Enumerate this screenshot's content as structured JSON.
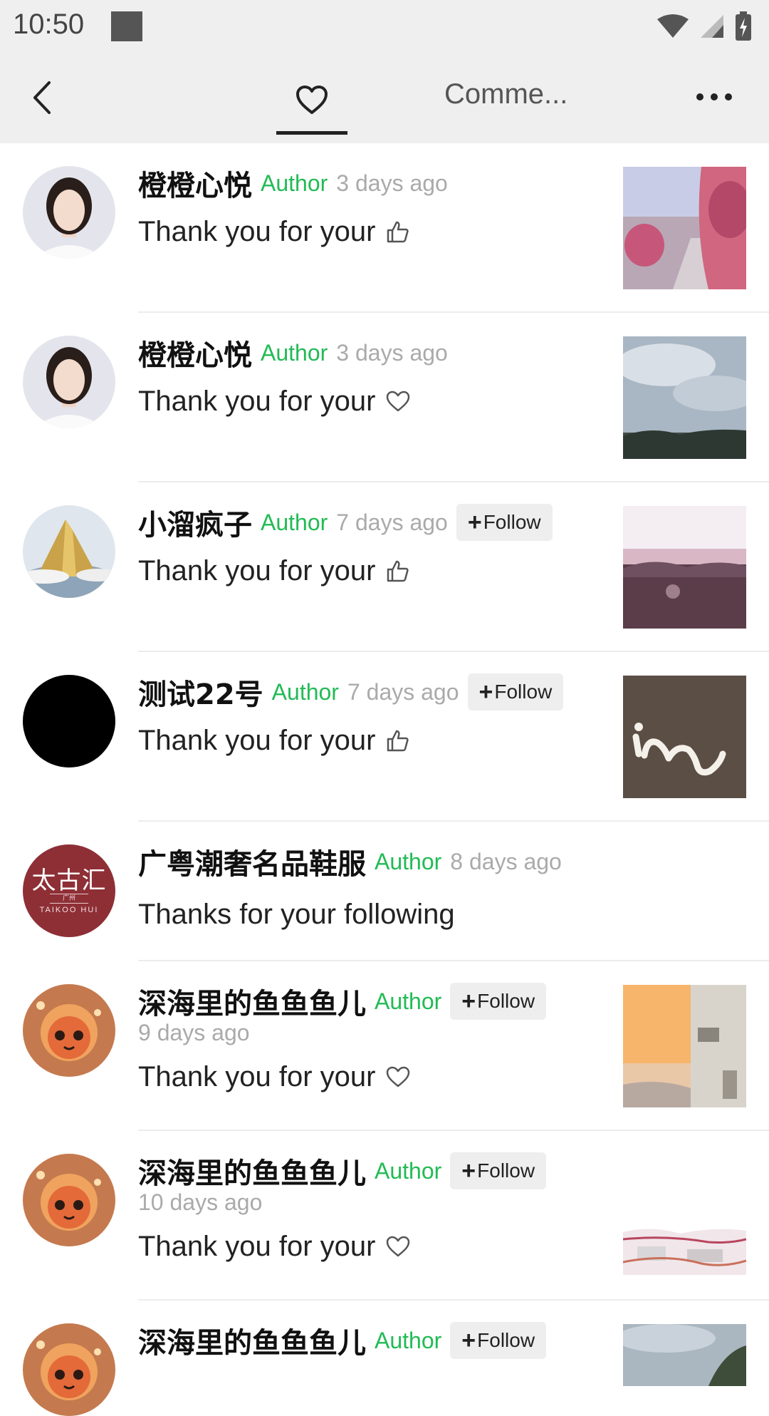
{
  "status_bar": {
    "time": "10:50"
  },
  "nav": {
    "comments_tab_label": "Comme..."
  },
  "rows": [
    {
      "username": "橙橙心悦",
      "author_tag": "Author",
      "time": "3 days ago",
      "message": "Thank you for your",
      "reaction_icon": "thumbs-up-icon"
    },
    {
      "username": "橙橙心悦",
      "author_tag": "Author",
      "time": "3 days ago",
      "message": "Thank you for your",
      "reaction_icon": "heart-icon"
    },
    {
      "username": "小溜疯子",
      "author_tag": "Author",
      "time": "7 days ago",
      "follow_label": "Follow",
      "message": "Thank you for your",
      "reaction_icon": "thumbs-up-icon"
    },
    {
      "username": "测试22号",
      "author_tag": "Author",
      "time": "7 days ago",
      "follow_label": "Follow",
      "message": "Thank you for your",
      "reaction_icon": "thumbs-up-icon"
    },
    {
      "username": "广粤潮奢名品鞋服",
      "author_tag": "Author",
      "time": "8 days ago",
      "message": "Thanks for your following",
      "avatar_text": "太古汇",
      "avatar_small": "广州",
      "avatar_sub": "TAIKOO HUI"
    },
    {
      "username": "深海里的鱼鱼鱼儿",
      "author_tag": "Author",
      "time": "9 days ago",
      "follow_label": "Follow",
      "message": "Thank you for your",
      "reaction_icon": "heart-icon"
    },
    {
      "username": "深海里的鱼鱼鱼儿",
      "author_tag": "Author",
      "time": "10 days ago",
      "follow_label": "Follow",
      "message": "Thank you for your",
      "reaction_icon": "heart-icon"
    },
    {
      "username": "深海里的鱼鱼鱼儿",
      "author_tag": "Author",
      "follow_label": "Follow"
    }
  ],
  "colors": {
    "author_tag": "#22bb55",
    "time": "#aaaaaa",
    "nav_bg": "#efefef",
    "follow_bg": "#eeeeee"
  }
}
